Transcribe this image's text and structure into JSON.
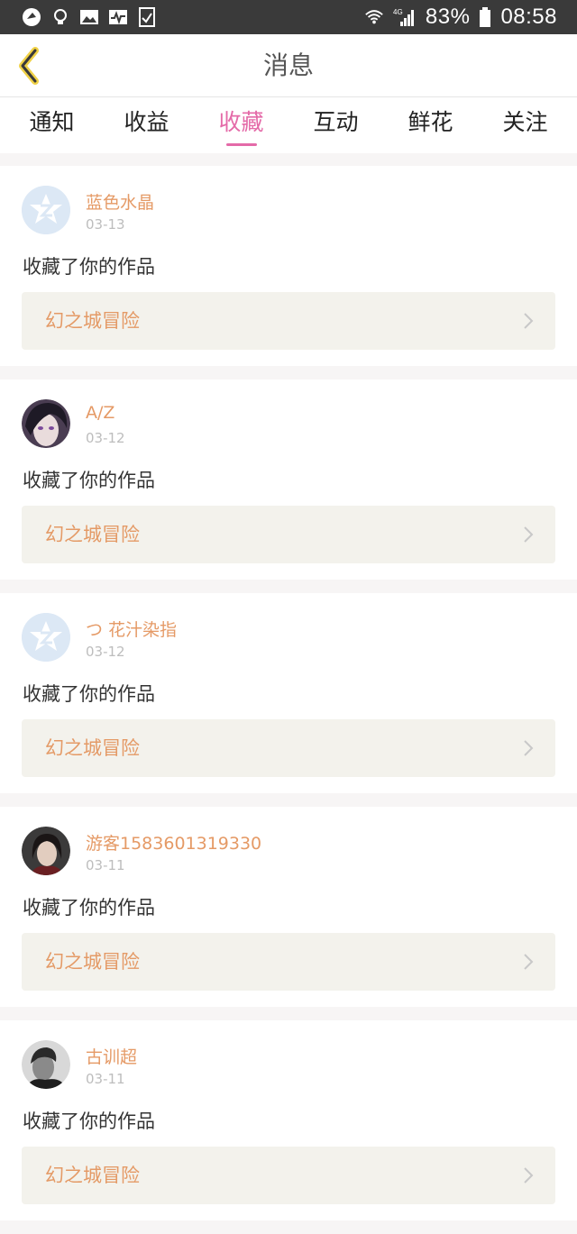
{
  "status_bar": {
    "battery": "83%",
    "time": "08:58",
    "network": "4G",
    "left_icons": [
      "notification-icon",
      "bulb-icon",
      "image-icon",
      "activity-icon",
      "checklist-icon"
    ]
  },
  "header": {
    "title": "消息"
  },
  "tabs": [
    {
      "label": "通知",
      "active": false
    },
    {
      "label": "收益",
      "active": false
    },
    {
      "label": "收藏",
      "active": true
    },
    {
      "label": "互动",
      "active": false
    },
    {
      "label": "鲜花",
      "active": false
    },
    {
      "label": "关注",
      "active": false
    }
  ],
  "colors": {
    "accent": "#e46aa8",
    "name": "#e59a66",
    "work_bg": "#f3f2ec"
  },
  "messages": [
    {
      "user": "蓝色水晶",
      "date": "03-13",
      "text": "收藏了你的作品",
      "work": "幻之城冒险",
      "avatar": "default-avatar"
    },
    {
      "user": "A/Z",
      "date": "03-12",
      "text": "收藏了你的作品",
      "work": "幻之城冒险",
      "avatar": "anime-avatar"
    },
    {
      "user": "つ 花汁染指",
      "date": "03-12",
      "text": "收藏了你的作品",
      "work": "幻之城冒险",
      "avatar": "default-avatar"
    },
    {
      "user": "游客1583601319330",
      "date": "03-11",
      "text": "收藏了你的作品",
      "work": "幻之城冒险",
      "avatar": "photo-avatar"
    },
    {
      "user": "古训超",
      "date": "03-11",
      "text": "收藏了你的作品",
      "work": "幻之城冒险",
      "avatar": "photo-avatar"
    }
  ]
}
